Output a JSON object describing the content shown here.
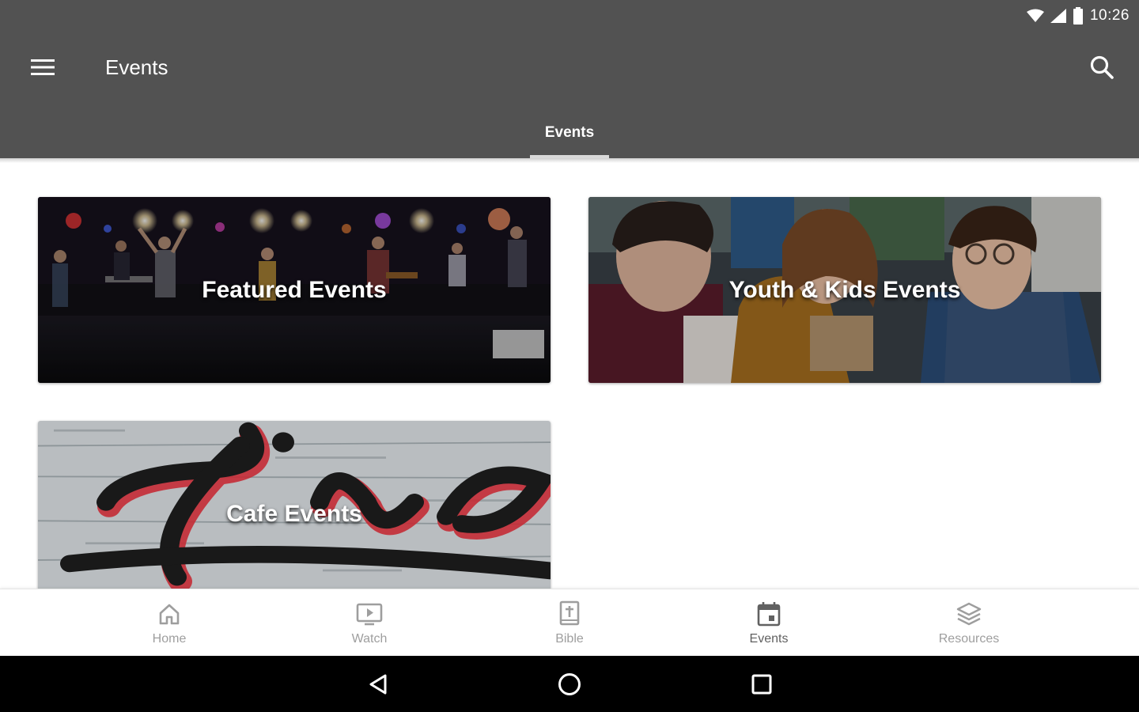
{
  "status_bar": {
    "time": "10:26",
    "icons": [
      "wifi-icon",
      "signal-icon",
      "battery-icon"
    ]
  },
  "app_bar": {
    "title": "Events",
    "menu_icon": "hamburger-menu-icon",
    "search_icon": "search-icon",
    "background_color": "#525252"
  },
  "tabs": [
    {
      "label": "Events",
      "selected": true
    }
  ],
  "cards": [
    {
      "title": "Featured Events",
      "image": "concert-worship-band-photo"
    },
    {
      "title": "Youth & Kids Events",
      "image": "smiling-teens-photo"
    },
    {
      "title": "Cafe Events",
      "image": "live-sign-wood-photo"
    }
  ],
  "bottom_nav": {
    "items": [
      {
        "label": "Home",
        "icon": "home-icon",
        "active": false
      },
      {
        "label": "Watch",
        "icon": "tv-play-icon",
        "active": false
      },
      {
        "label": "Bible",
        "icon": "bible-icon",
        "active": false
      },
      {
        "label": "Events",
        "icon": "calendar-icon",
        "active": true
      },
      {
        "label": "Resources",
        "icon": "layers-icon",
        "active": false
      }
    ]
  },
  "system_nav": {
    "buttons": [
      "back-icon",
      "home-circle-icon",
      "recents-icon"
    ]
  }
}
